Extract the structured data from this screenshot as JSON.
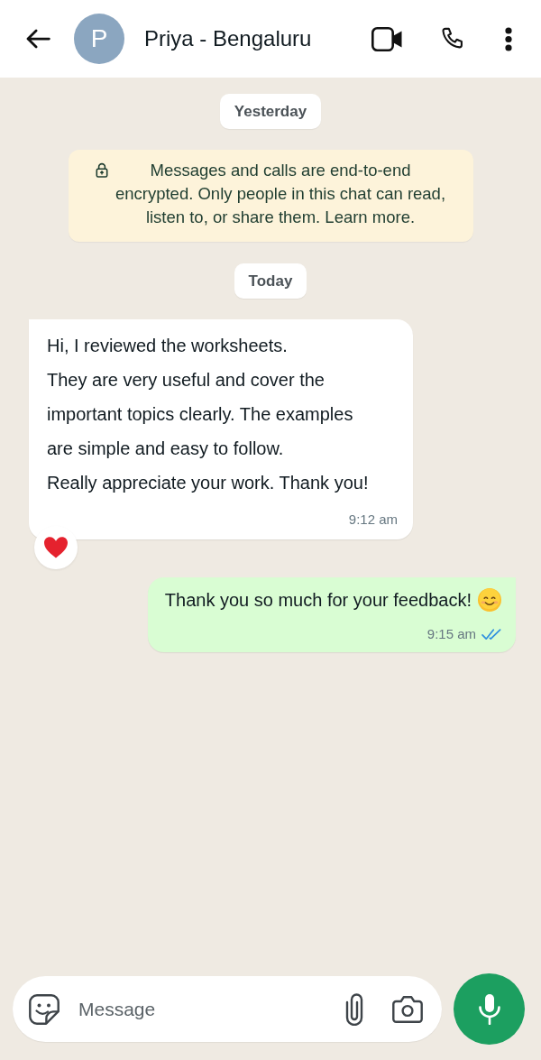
{
  "header": {
    "avatar_letter": "P",
    "contact_name": "Priya - Bengaluru"
  },
  "chat": {
    "items": [
      {
        "kind": "date",
        "label": "Yesterday"
      },
      {
        "kind": "notice",
        "text": "Messages and calls are end-to-end encrypted. Only people in this chat can read, listen to, or share them. Learn more."
      },
      {
        "kind": "date",
        "label": "Today"
      },
      {
        "kind": "incoming",
        "text": "Hi, I reviewed the worksheets.\nThey are very useful and cover the important topics clearly. The examples are simple and easy to follow.\nReally appreciate your work. Thank you!",
        "has_emoji": false,
        "time": "9:12 am",
        "reacted": true
      },
      {
        "kind": "outgoing",
        "text": "Thank you so much for your feedback!",
        "has_emoji": true,
        "time": "9:15 am",
        "read": true,
        "reacted": false
      }
    ]
  },
  "composer": {
    "placeholder": "Message"
  }
}
